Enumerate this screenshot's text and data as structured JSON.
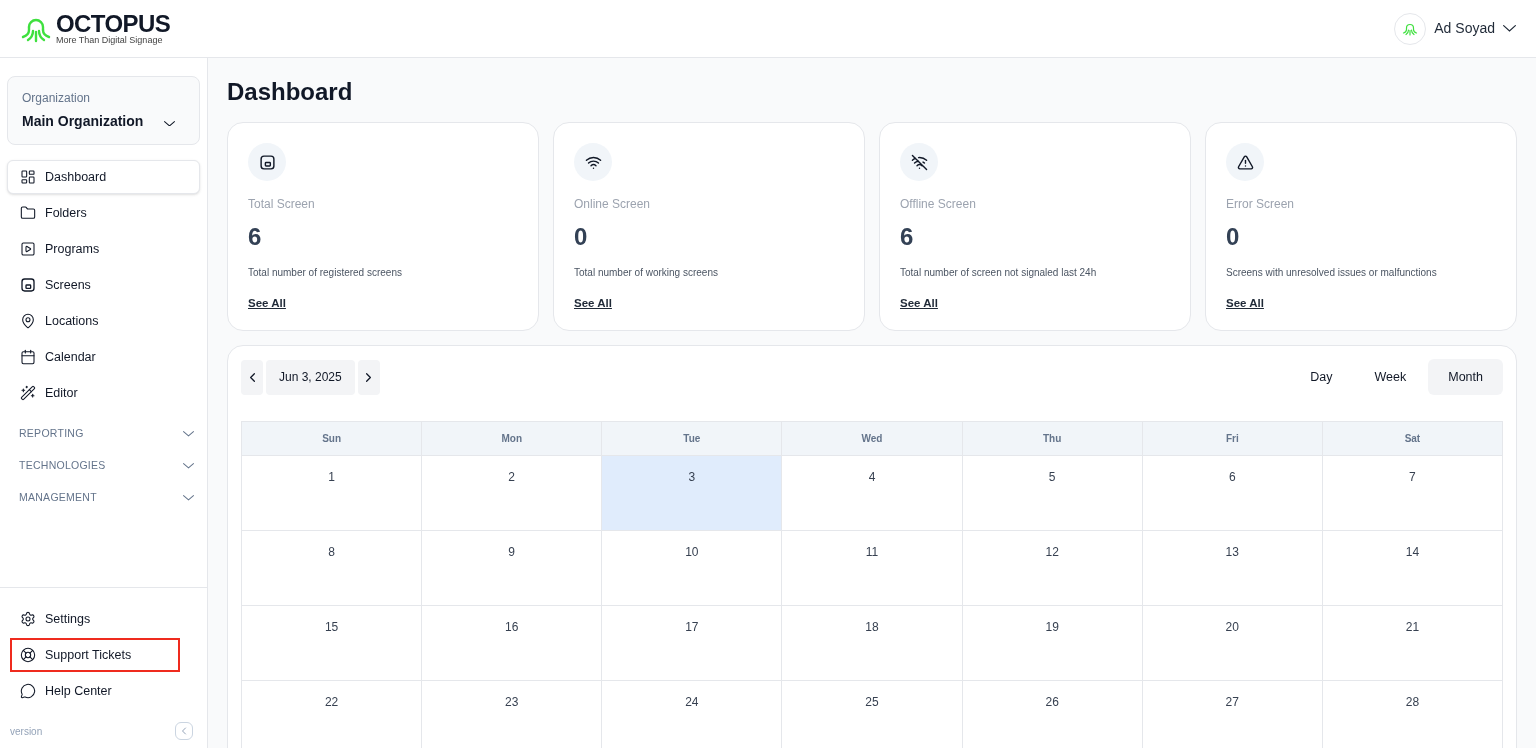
{
  "header": {
    "logo": {
      "name": "OCTOPUS",
      "tagline": "More Than Digital Signage"
    },
    "user": {
      "name": "Ad Soyad"
    }
  },
  "sidebar": {
    "organization": {
      "label": "Organization",
      "value": "Main Organization"
    },
    "items": [
      {
        "label": "Dashboard",
        "selected": true
      },
      {
        "label": "Folders",
        "selected": false
      },
      {
        "label": "Programs",
        "selected": false
      },
      {
        "label": "Screens",
        "selected": false
      },
      {
        "label": "Locations",
        "selected": false
      },
      {
        "label": "Calendar",
        "selected": false
      },
      {
        "label": "Editor",
        "selected": false
      }
    ],
    "sections": [
      {
        "label": "REPORTING",
        "expanded": false
      },
      {
        "label": "TECHNOLOGIES",
        "expanded": false
      },
      {
        "label": "MANAGEMENT",
        "expanded": false
      }
    ],
    "bottom_items": [
      {
        "label": "Settings",
        "highlighted": false
      },
      {
        "label": "Support Tickets",
        "highlighted": true
      },
      {
        "label": "Help Center",
        "highlighted": false
      }
    ],
    "version": "version"
  },
  "page": {
    "title": "Dashboard"
  },
  "stats": [
    {
      "title": "Total Screen",
      "value": "6",
      "description": "Total number of registered screens",
      "link": "See All"
    },
    {
      "title": "Online Screen",
      "value": "0",
      "description": "Total number of working screens",
      "link": "See All"
    },
    {
      "title": "Offline Screen",
      "value": "6",
      "description": "Total number of screen not signaled last 24h",
      "link": "See All"
    },
    {
      "title": "Error Screen",
      "value": "0",
      "description": "Screens with unresolved issues or malfunctions",
      "link": "See All"
    }
  ],
  "calendar": {
    "date": "Jun 3, 2025",
    "views": [
      {
        "label": "Day",
        "selected": false
      },
      {
        "label": "Week",
        "selected": false
      },
      {
        "label": "Month",
        "selected": true
      }
    ],
    "weekdays": [
      "Sun",
      "Mon",
      "Tue",
      "Wed",
      "Thu",
      "Fri",
      "Sat"
    ],
    "weeks": [
      [
        {
          "day": "1",
          "selected": false
        },
        {
          "day": "2",
          "selected": false
        },
        {
          "day": "3",
          "selected": true
        },
        {
          "day": "4",
          "selected": false
        },
        {
          "day": "5",
          "selected": false
        },
        {
          "day": "6",
          "selected": false
        },
        {
          "day": "7",
          "selected": false
        }
      ],
      [
        {
          "day": "8",
          "selected": false
        },
        {
          "day": "9",
          "selected": false
        },
        {
          "day": "10",
          "selected": false
        },
        {
          "day": "11",
          "selected": false
        },
        {
          "day": "12",
          "selected": false
        },
        {
          "day": "13",
          "selected": false
        },
        {
          "day": "14",
          "selected": false
        }
      ],
      [
        {
          "day": "15",
          "selected": false
        },
        {
          "day": "16",
          "selected": false
        },
        {
          "day": "17",
          "selected": false
        },
        {
          "day": "18",
          "selected": false
        },
        {
          "day": "19",
          "selected": false
        },
        {
          "day": "20",
          "selected": false
        },
        {
          "day": "21",
          "selected": false
        }
      ],
      [
        {
          "day": "22",
          "selected": false
        },
        {
          "day": "23",
          "selected": false
        },
        {
          "day": "24",
          "selected": false
        },
        {
          "day": "25",
          "selected": false
        },
        {
          "day": "26",
          "selected": false
        },
        {
          "day": "27",
          "selected": false
        },
        {
          "day": "28",
          "selected": false
        }
      ]
    ]
  }
}
